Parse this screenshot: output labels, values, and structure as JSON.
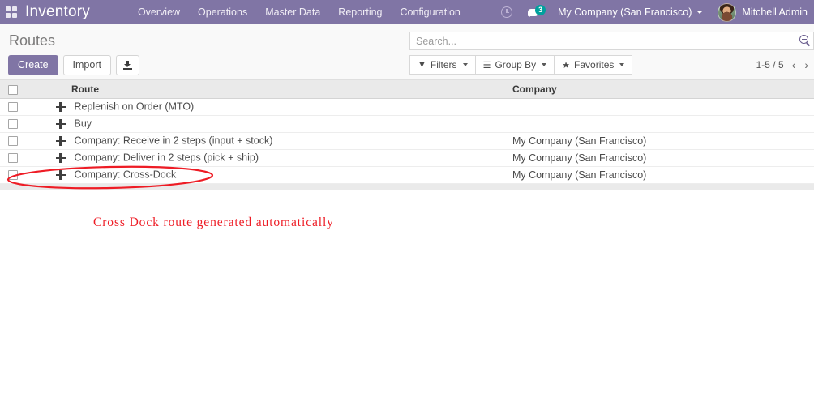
{
  "navbar": {
    "apps_icon": "apps-grid-icon",
    "app_title": "Inventory",
    "menu": [
      {
        "label": "Overview"
      },
      {
        "label": "Operations"
      },
      {
        "label": "Master Data"
      },
      {
        "label": "Reporting"
      },
      {
        "label": "Configuration"
      }
    ],
    "activity_icon": "clock-icon",
    "messages_icon": "chat-bubble-icon",
    "messages_count": "3",
    "company_selector": "My Company (San Francisco)",
    "user_name": "Mitchell Admin",
    "accent_color": "#8075a5",
    "badge_color": "#00a09d"
  },
  "control_panel": {
    "breadcrumb": "Routes",
    "create_label": "Create",
    "import_label": "Import",
    "export_icon": "download-icon",
    "search": {
      "placeholder": "Search...",
      "value": "",
      "icon": "search-icon"
    },
    "filters_label": "Filters",
    "filters_icon": "funnel-icon",
    "groupby_label": "Group By",
    "groupby_icon": "list-lines-icon",
    "favorites_label": "Favorites",
    "favorites_icon": "star-icon",
    "pager": {
      "range": "1-5 / 5",
      "prev_icon": "chevron-left-icon",
      "next_icon": "chevron-right-icon"
    }
  },
  "table": {
    "columns": [
      {
        "key": "route",
        "label": "Route"
      },
      {
        "key": "company",
        "label": "Company"
      }
    ],
    "rows": [
      {
        "route": "Replenish on Order (MTO)",
        "company": ""
      },
      {
        "route": "Buy",
        "company": ""
      },
      {
        "route": "Company: Receive in 2 steps (input + stock)",
        "company": "My Company (San Francisco)"
      },
      {
        "route": "Company: Deliver in 2 steps (pick + ship)",
        "company": "My Company (San Francisco)"
      },
      {
        "route": "Company: Cross-Dock",
        "company": "My Company (San Francisco)"
      }
    ]
  },
  "annotations": {
    "ellipse_color": "#ee1c25",
    "note_text": "Cross Dock route generated automatically",
    "note_color": "#ee1c25"
  }
}
